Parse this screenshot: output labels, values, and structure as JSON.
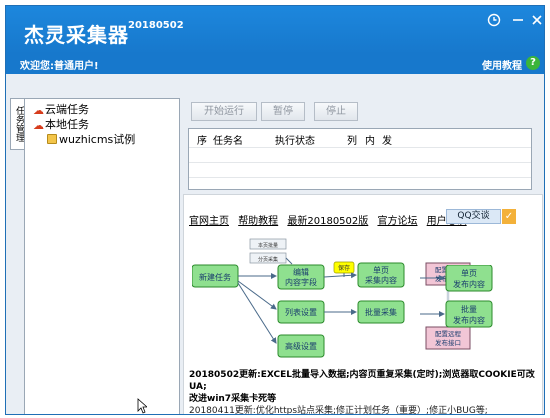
{
  "app": {
    "title": "杰灵采集器",
    "version": "20180502",
    "welcome": "欢迎您:普通用户!",
    "help": "使用教程"
  },
  "side_tab": "任务管理",
  "tree": [
    {
      "label": "云端任务",
      "icon": "cloud-icon"
    },
    {
      "label": "本地任务",
      "icon": "cloud-icon"
    },
    {
      "label": "wuzhicms试例",
      "icon": "folder-icon"
    }
  ],
  "toolbar": {
    "start": "开始运行",
    "pause": "暂停",
    "stop": "停止"
  },
  "table": {
    "headers": [
      "序",
      "任务名",
      "执行状态",
      "列",
      "内",
      "发"
    ]
  },
  "links": [
    "官网主页",
    "帮助教程",
    "最新20180502版",
    "官方论坛",
    "用户必读"
  ],
  "qq": "QQ交谈",
  "flow": {
    "new_task": "新建任务",
    "edit_fields": [
      "编辑",
      "内容字段"
    ],
    "list_settings": "列表设置",
    "advanced": "高级设置",
    "single_page_collect": [
      "单页",
      "采集内容"
    ],
    "batch_collect": "批量采集",
    "single_page_publish": [
      "单页",
      "发布内容"
    ],
    "batch_publish": [
      "批量",
      "发布内容"
    ],
    "config_local_publish": [
      "配置本地",
      "发布规则"
    ],
    "config_remote_publish": [
      "配置远程",
      "发布接口"
    ],
    "tag_1": "本页批量",
    "tag_2": "分页采集",
    "tag_save": "保存"
  },
  "news": {
    "line1": "20180502更新:EXCEL批量导入数据;内容页重复采集(定时);浏览器取COOKIE可改UA;",
    "line2": "改进win7采集卡死等",
    "line3": "20180411更新:优化https站点采集;修正计划任务（重要）;修正小BUG等;"
  },
  "colors": {
    "titlebar": "#1778cc",
    "flow_box": "#8fe08f",
    "flow_box_border": "#2b8a2b",
    "flow_pink": "#f2c6d6",
    "flow_yellow": "#ffff00"
  }
}
